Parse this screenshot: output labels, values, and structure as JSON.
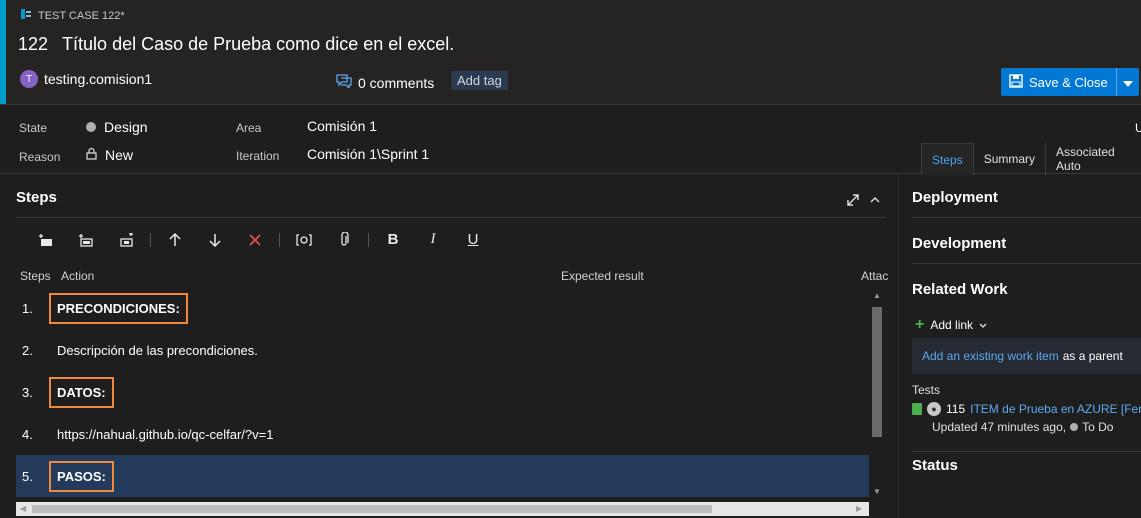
{
  "header": {
    "type_label": "TEST CASE 122*",
    "id": "122",
    "title": "Título del Caso de Prueba como dice en el excel.",
    "user_initial": "T",
    "user_name": "testing.comision1",
    "comments": "0 comments",
    "add_tag": "Add tag",
    "save_label": "Save & Close",
    "accent_color": "#009ccc"
  },
  "fields": {
    "state_label": "State",
    "state_value": "Design",
    "reason_label": "Reason",
    "reason_value": "New",
    "area_label": "Area",
    "area_value": "Comisión 1",
    "iteration_label": "Iteration",
    "iteration_value": "Comisión 1\\Sprint 1",
    "right_cut_letter": "U"
  },
  "tabs": [
    "Steps",
    "Summary",
    "Associated Auto"
  ],
  "steps": {
    "title": "Steps",
    "columns": {
      "steps": "Steps",
      "action": "Action",
      "expected": "Expected result",
      "attachments": "Attac"
    },
    "rows": [
      {
        "num": "1.",
        "text": "PRECONDICIONES:",
        "boxed": true
      },
      {
        "num": "2.",
        "text": "Descripción de las precondiciones.",
        "boxed": false
      },
      {
        "num": "3.",
        "text": "DATOS:",
        "boxed": true
      },
      {
        "num": "4.",
        "text": "https://nahual.github.io/qc-celfar/?v=1",
        "boxed": false
      },
      {
        "num": "5.",
        "text": "PASOS:",
        "boxed": true
      }
    ]
  },
  "right": {
    "deployment": "Deployment",
    "development": "Development",
    "related_work": "Related Work",
    "add_link": "Add link",
    "existing_link": "Add an existing work item",
    "existing_suffix": "as a parent",
    "tests_label": "Tests",
    "test_id": "115",
    "test_title": "ITEM de Prueba en AZURE [Fern",
    "test_updated": "Updated 47 minutes ago,",
    "test_state": "To Do",
    "status": "Status"
  }
}
